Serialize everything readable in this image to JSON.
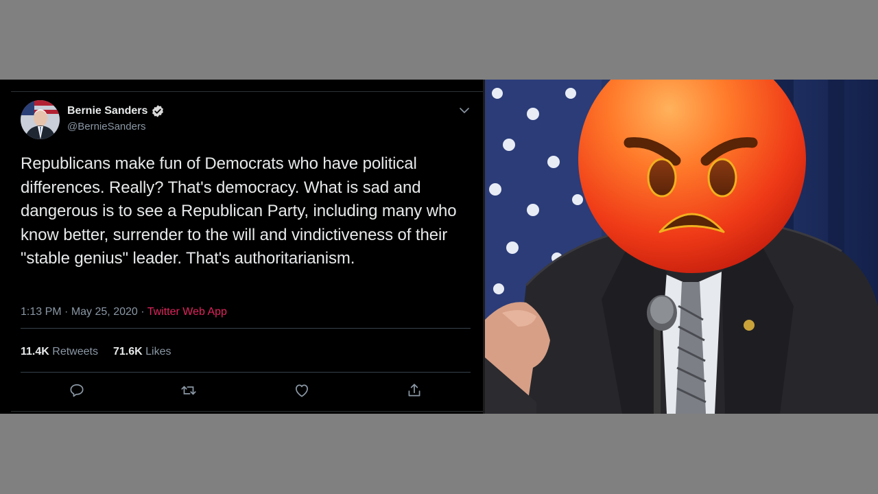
{
  "tweet": {
    "author_name": "Bernie Sanders",
    "handle": "@BernieSanders",
    "text": "Republicans make fun of Democrats who have political differences. Really? That's democracy. What is sad and dangerous is to see a Republican Party, including many who know better, surrender to the will and vindictiveness of their \"stable genius\" leader. That's authoritarianism.",
    "time": "1:13 PM",
    "date": "May 25, 2020",
    "separator": "·",
    "source": "Twitter Web App",
    "retweets_count": "11.4K",
    "retweets_label": "Retweets",
    "likes_count": "71.6K",
    "likes_label": "Likes"
  },
  "icons": {
    "verified": "verified-badge-icon",
    "menu": "chevron-down-icon",
    "reply": "reply-icon",
    "retweet": "retweet-icon",
    "like": "heart-icon",
    "share": "share-icon",
    "overlay": "angry-face-emoji"
  },
  "colors": {
    "background": "#000000",
    "text": "#e7e9ea",
    "muted": "#8b98a5",
    "source_link": "#e0245e",
    "letterbox": "#808080"
  }
}
